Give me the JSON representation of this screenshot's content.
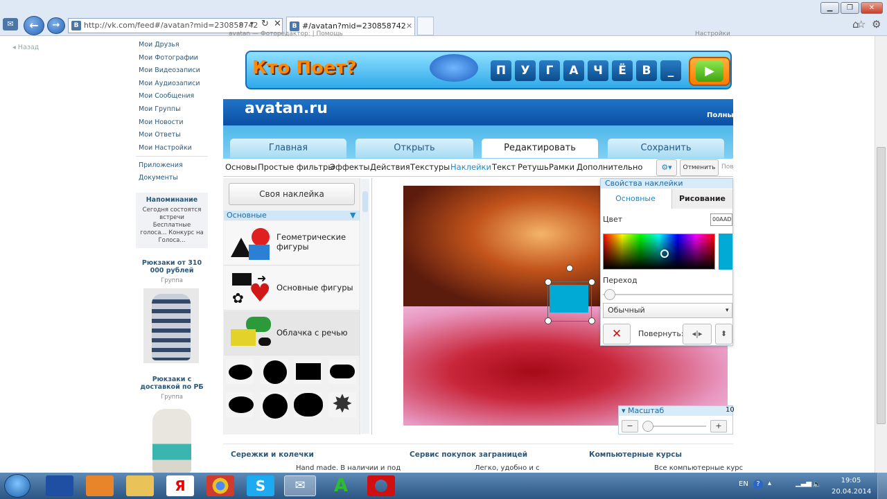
{
  "browser": {
    "url": "http://vk.com/feed#/avatan?mid=230858742",
    "tab_title": "#/avatan?mid=230858742",
    "fav": "B"
  },
  "sidebar": {
    "back": "Назад",
    "items": [
      "Мои Друзья",
      "Мои Фотографии",
      "Мои Видеозаписи",
      "Мои Аудиозаписи",
      "Мои Сообщения",
      "Мои Группы",
      "Мои Новости",
      "Мои Ответы",
      "Мои Настройки"
    ],
    "extra": [
      "Приложения",
      "Документы"
    ],
    "reminder": {
      "title": "Напоминание",
      "text": "Сегодня состоятся встречи Бесплатные голоса... Конкурс на Голоса..."
    },
    "ads": [
      {
        "title": "Рюкзаки от 310 000 рублей",
        "sub": "Группа"
      },
      {
        "title": "Рюкзаки с доставкой по РБ",
        "sub": "Группа"
      }
    ]
  },
  "app": {
    "top_crumb": "avatan — Фоторедактор: | Помощь",
    "top_right": "Настройки",
    "banner": {
      "title": "Кто Поет?",
      "letters": [
        "П",
        "У",
        "Г",
        "А",
        "Ч",
        "Ё",
        "В",
        "_"
      ]
    },
    "site": "avatan.ru",
    "full": "Полный",
    "main_tabs": [
      "Главная",
      "Открыть",
      "Редактировать",
      "Сохранить"
    ],
    "sub_tabs": [
      "Основы",
      "Простые фильтры",
      "Эффекты",
      "Действия",
      "Текстуры",
      "Наклейки",
      "Текст",
      "Ретушь",
      "Рамки",
      "Дополнительно"
    ],
    "cancel": "Отменить",
    "repeat": "Пов",
    "own_sticker": "Своя наклейка",
    "group": "Основные",
    "categories": [
      "Геометрические фигуры",
      "Основные фигуры",
      "Облачка с речью"
    ],
    "props": {
      "title": "Свойства наклейки",
      "tabs": [
        "Основные",
        "Рисование"
      ],
      "color_label": "Цвет",
      "color_value": "00AAD",
      "transition": "Переход",
      "mode": "Обычный",
      "rotate": "Повернуть:"
    },
    "scale": {
      "label": "Масштаб",
      "value": "10"
    },
    "ads_bottom": [
      {
        "title": "Сережки и колечки",
        "text": "Hand made. В наличии и под"
      },
      {
        "title": "Сервис покупок заграницей",
        "text": "Легко, удобно и с"
      },
      {
        "title": "Компьютерные курсы",
        "text": "Все компьютерные курс"
      }
    ]
  },
  "taskbar": {
    "lang": "EN",
    "time": "19:05",
    "date": "20.04.2014"
  },
  "colors": {
    "accent": "#00AAD4",
    "vk": "#4a76a8",
    "taskbar": "#2b5582"
  }
}
